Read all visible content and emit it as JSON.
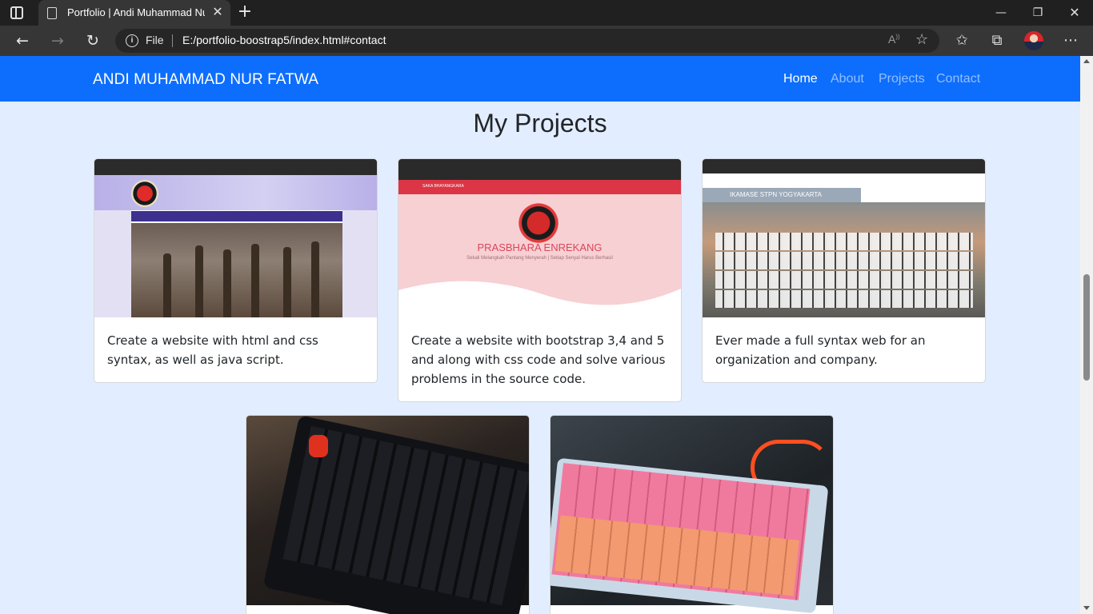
{
  "browser": {
    "tab_title": "Portfolio | Andi Muhammad Nur Fatwa",
    "tab_close": "✕",
    "new_tab": "+",
    "address_scheme": "File",
    "url": "E:/portfolio-boostrap5/index.html#contact",
    "read_aloud": "A)",
    "window": {
      "minimize": "—",
      "maximize": "❐",
      "close": "✕"
    },
    "nav": {
      "back": "←",
      "forward": "→",
      "reload": "↻"
    },
    "more": "⋯",
    "info": "i"
  },
  "site": {
    "brand": "ANDI MUHAMMAD NUR FATWA",
    "nav": [
      {
        "label": "Home",
        "active": true
      },
      {
        "label": "About",
        "active": false
      },
      {
        "label": "Projects",
        "active": false
      },
      {
        "label": "Contact",
        "active": false
      }
    ]
  },
  "projects": {
    "title": "My Projects",
    "cards": [
      {
        "image": "scout-website-screenshot",
        "text": "Create a website with html and css syntax, as well as java script."
      },
      {
        "image": "prasbhara-website-screenshot",
        "text": "Create a website with bootstrap 3,4 and 5 and along with css code and solve various problems in the source code."
      },
      {
        "image": "ikamase-website-screenshot",
        "text": "Ever made a full syntax web for an organization and company."
      },
      {
        "image": "dark-mechanical-keyboard-photo",
        "text": ""
      },
      {
        "image": "pink-mechanical-keyboard-photo",
        "text": ""
      }
    ]
  },
  "thumbnails": {
    "prasbhara_title": "PRASBHARA ENREKANG",
    "prasbhara_subtitle": "Sekali Melangkah Pantang Menyerah | Setiap Senyal Harus Berhasil",
    "prasbhara_nav_brand": "SAKA BHAYANGKARA",
    "ikamase_banner": "IKAMASE STPN YOGYAKARTA"
  },
  "colors": {
    "navbar": "#0d6efd",
    "page_background": "#e2edff",
    "browser_dark": "#202020",
    "accent_red": "#dc3545"
  }
}
